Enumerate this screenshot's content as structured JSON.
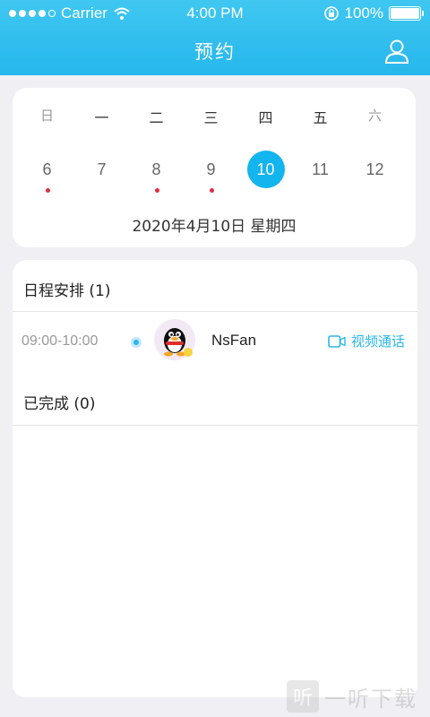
{
  "status_bar": {
    "carrier": "Carrier",
    "time": "4:00 PM",
    "battery": "100%"
  },
  "header": {
    "title": "预约"
  },
  "calendar": {
    "weekdays": [
      "日",
      "一",
      "二",
      "三",
      "四",
      "五",
      "六"
    ],
    "days": [
      {
        "num": "6",
        "has_event": true
      },
      {
        "num": "7",
        "has_event": false
      },
      {
        "num": "8",
        "has_event": true
      },
      {
        "num": "9",
        "has_event": true
      },
      {
        "num": "10",
        "has_event": false,
        "selected": true
      },
      {
        "num": "11",
        "has_event": false
      },
      {
        "num": "12",
        "has_event": false
      }
    ],
    "selected_label": "2020年4月10日   星期四"
  },
  "schedule": {
    "title": "日程安排 (1)",
    "items": [
      {
        "time": "09:00-10:00",
        "name": "NsFan",
        "action": "视频通话"
      }
    ],
    "completed_title": "已完成 (0)"
  },
  "watermark": {
    "logo": "听",
    "text": "一听下载"
  },
  "colors": {
    "accent": "#13b5ee",
    "event_dot": "#e42b45",
    "header_top": "#3fc7f1",
    "header_bottom": "#26b7ec"
  }
}
